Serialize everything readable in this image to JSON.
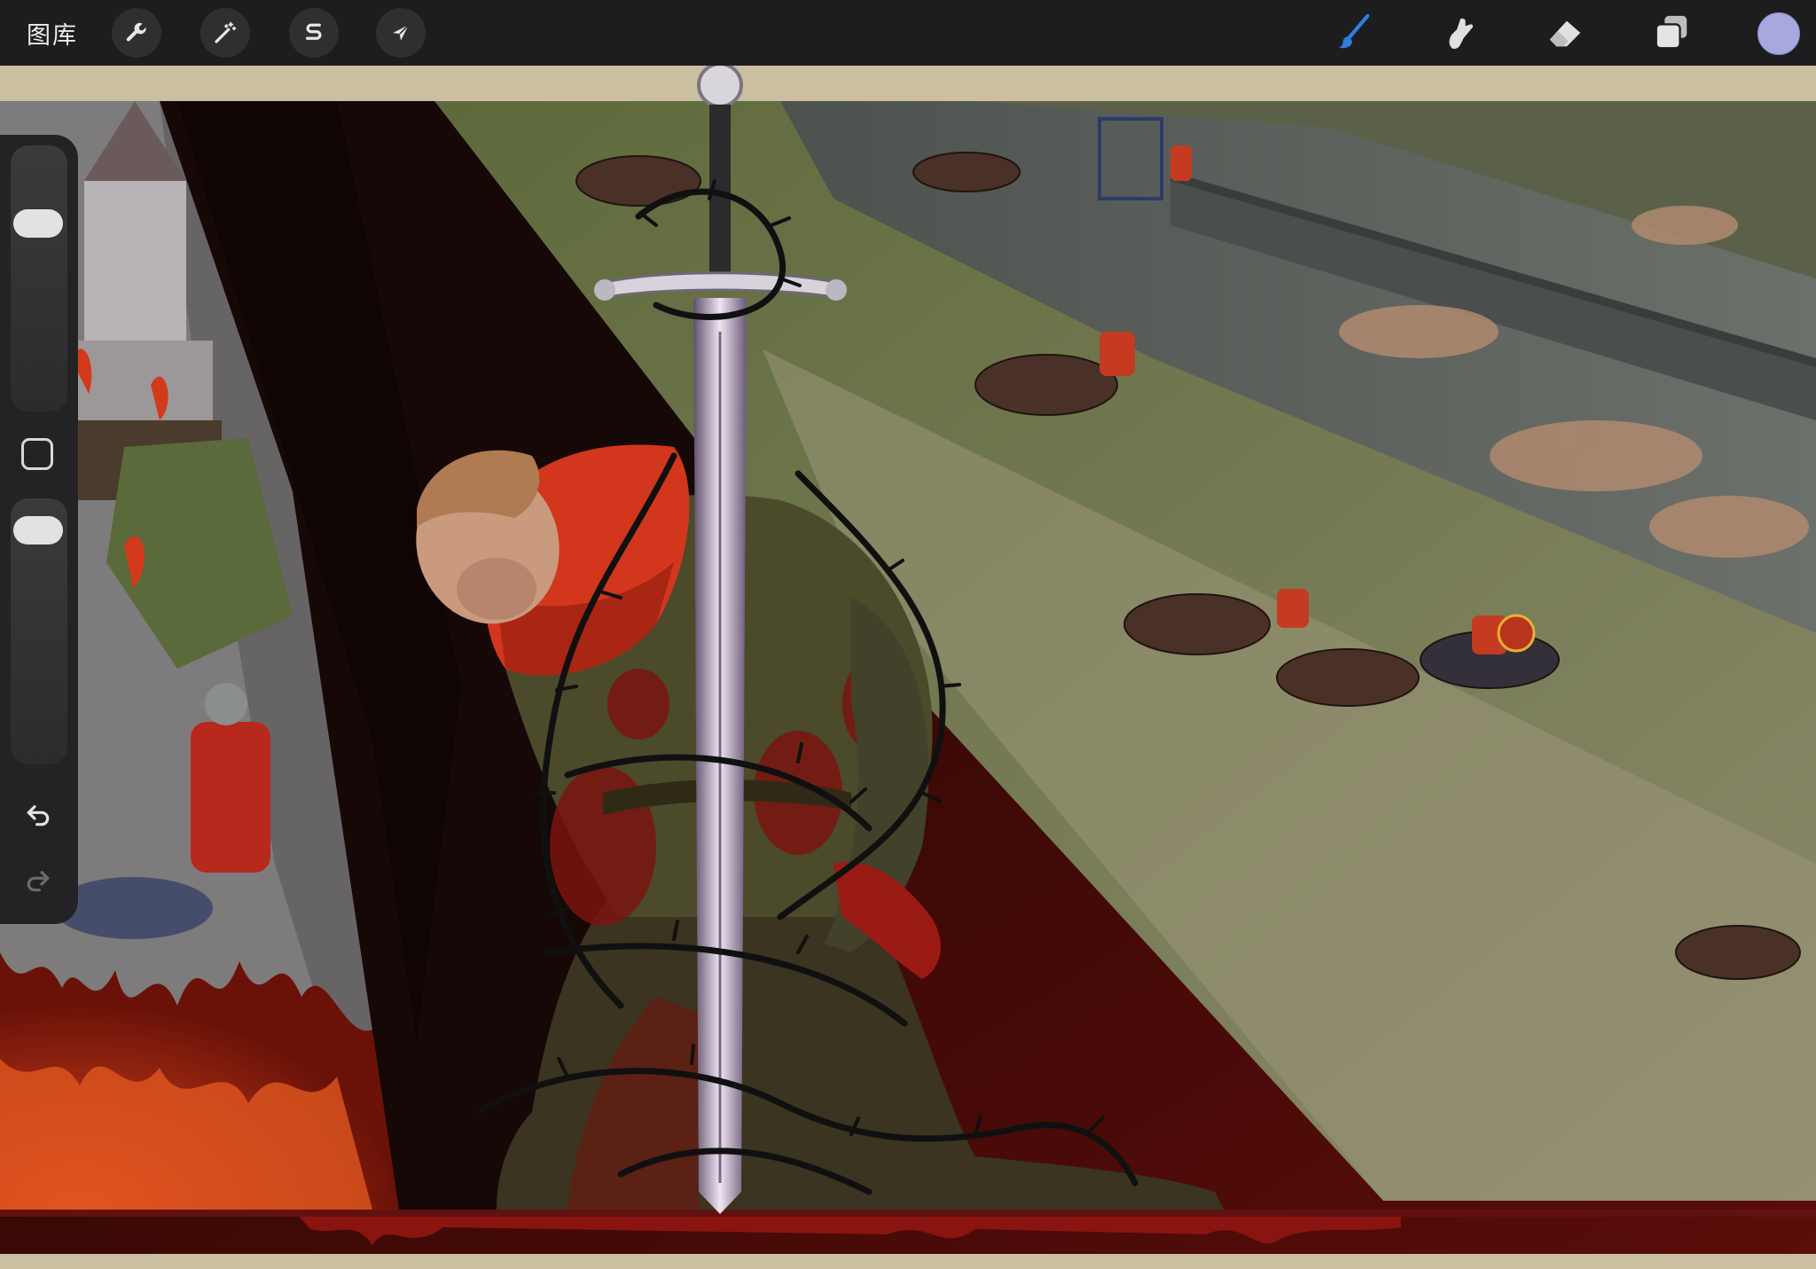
{
  "toolbar": {
    "gallery_label": "图库",
    "left_tools": [
      {
        "name": "actions",
        "icon": "wrench-icon"
      },
      {
        "name": "adjustments",
        "icon": "magic-wand-icon"
      },
      {
        "name": "selection",
        "icon": "selection-s-icon"
      },
      {
        "name": "transform",
        "icon": "arrow-cursor-icon"
      }
    ],
    "right_tools": [
      {
        "name": "brush",
        "icon": "brush-icon",
        "active": true
      },
      {
        "name": "smudge",
        "icon": "smudge-icon",
        "active": false
      },
      {
        "name": "eraser",
        "icon": "eraser-icon",
        "active": false
      },
      {
        "name": "layers",
        "icon": "layers-icon",
        "active": false
      }
    ],
    "current_color": "#a7a8e0",
    "active_tool_color": "#2f7de0"
  },
  "sidebar": {
    "brush_size_icon": "brush-size-slider",
    "modify_icon": "modify-square-icon",
    "opacity_icon": "opacity-slider",
    "undo_icon": "undo-icon",
    "redo_icon": "redo-icon"
  },
  "artwork": {
    "subject": "kneeling-knight-with-sword-and-thorns",
    "palette": {
      "blood": "#5a0f0c",
      "dark_red": "#2a0705",
      "scarf": "#d2361d",
      "tunic": "#4a4a2a",
      "parchment": "#cfc3a6",
      "stone": "#5b5f5e",
      "grass": "#5c6b3b",
      "fire": "#c2321a"
    }
  }
}
